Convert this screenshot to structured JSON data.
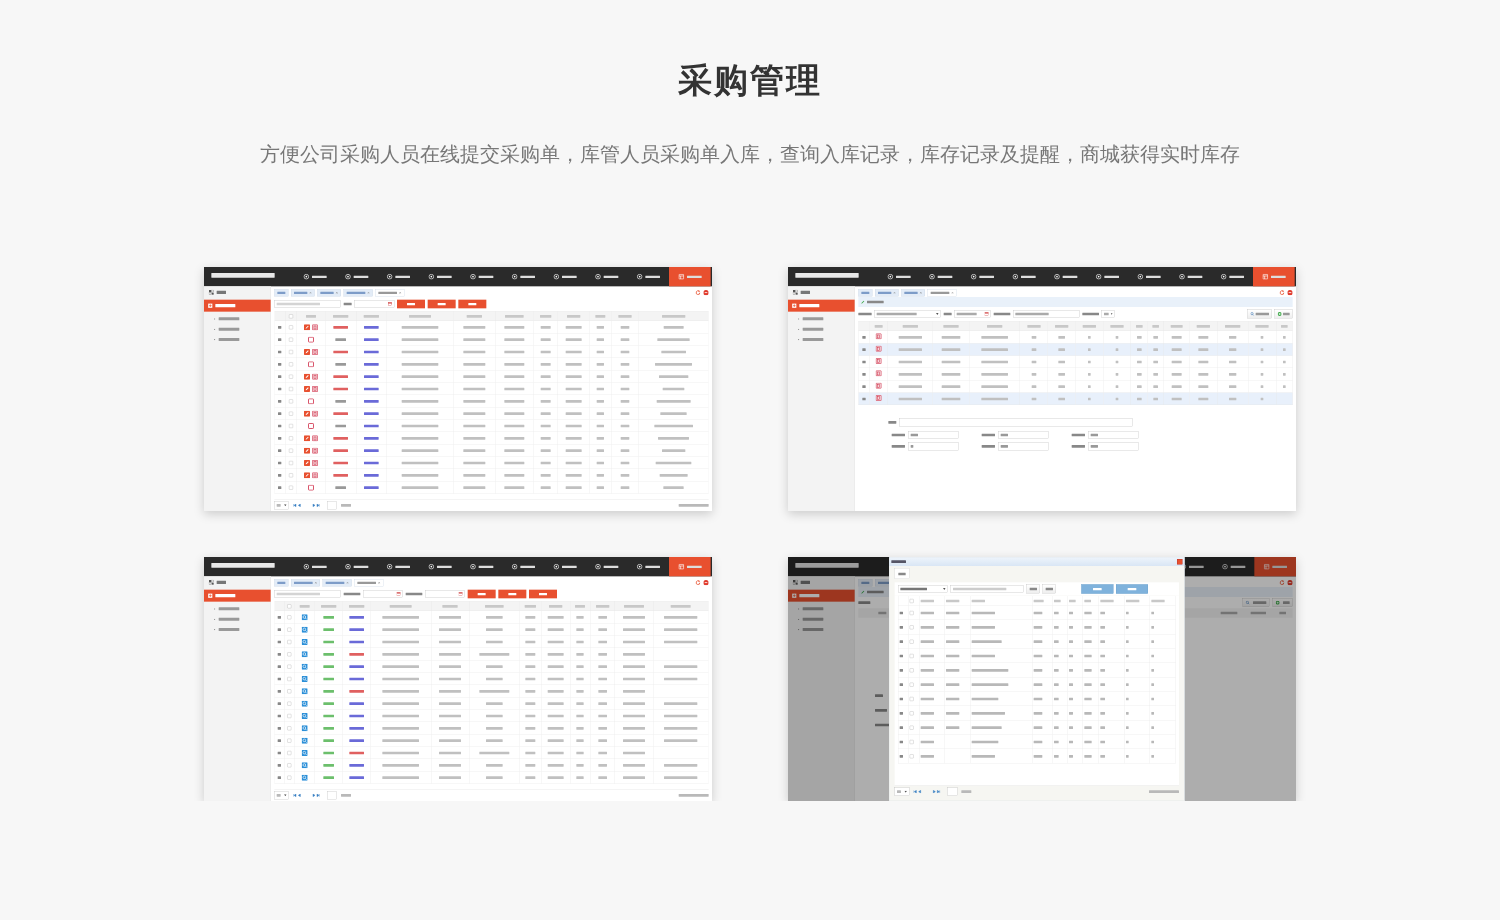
{
  "heading": "采购管理",
  "subtitle": "方便公司采购人员在线提交采购单，库管人员采购单入库，查询入库记录，库存记录及提醒，商城获得实时库存",
  "screenshots": [
    {
      "kind": "order_list"
    },
    {
      "kind": "order_form"
    },
    {
      "kind": "receipt_list"
    },
    {
      "kind": "product_dialog"
    }
  ]
}
